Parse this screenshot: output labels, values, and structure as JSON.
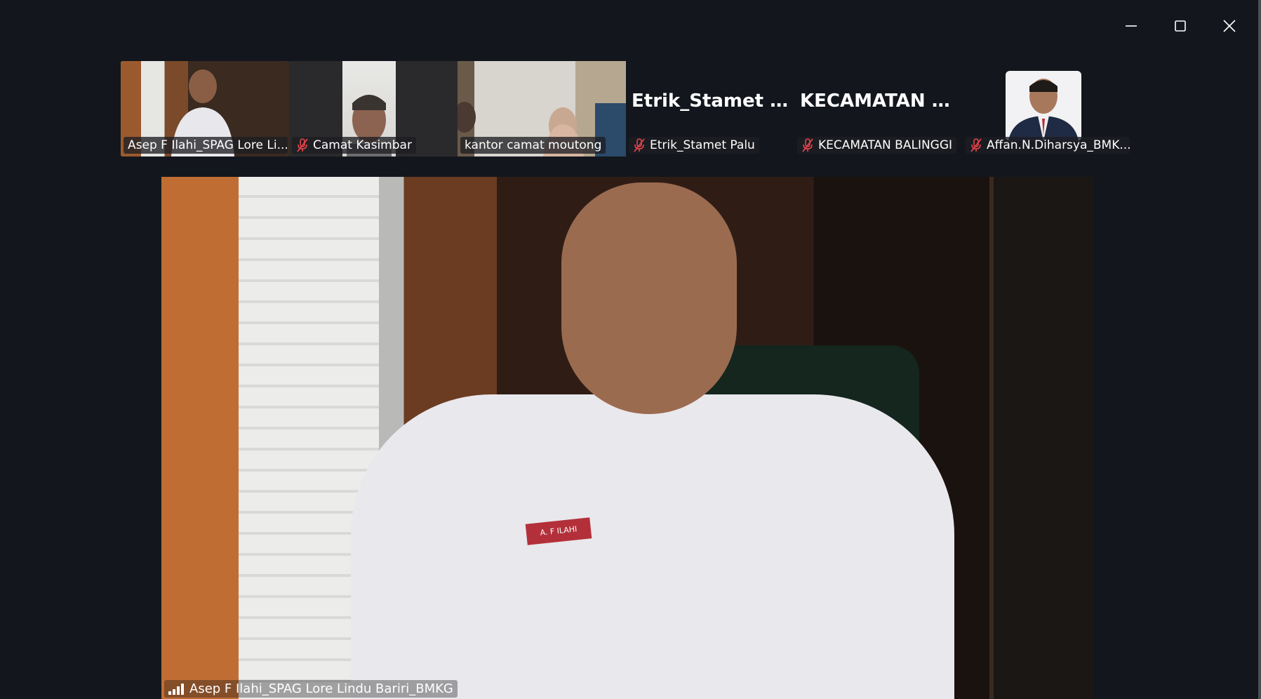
{
  "window": {
    "minimize": "minimize",
    "maximize": "maximize",
    "close": "close"
  },
  "participants": [
    {
      "name": "Asep F Ilahi_SPAG Lore Li...",
      "muted": false,
      "active": true,
      "video": true
    },
    {
      "name": "Camat Kasimbar",
      "muted": true,
      "active": false,
      "video": true
    },
    {
      "name": "kantor camat moutong",
      "muted": false,
      "active": false,
      "video": true
    },
    {
      "name": "Etrik_Stamet Palu",
      "display_title": "Etrik_Stamet Palu",
      "muted": true,
      "active": false,
      "video": false
    },
    {
      "name": "KECAMATAN BALINGGI",
      "display_title": "KECAMATAN  B...",
      "muted": true,
      "active": false,
      "video": false
    },
    {
      "name": "Affan.N.Diharsya_BMK...",
      "muted": true,
      "active": false,
      "video": false
    }
  ],
  "speaker": {
    "name": "Asep F Ilahi_SPAG Lore Lindu Bariri_BMKG",
    "nametag": "A. F ILAHI"
  },
  "colors": {
    "background": "#13171d",
    "active_border": "#23d984",
    "mute_icon": "#e8434c"
  }
}
